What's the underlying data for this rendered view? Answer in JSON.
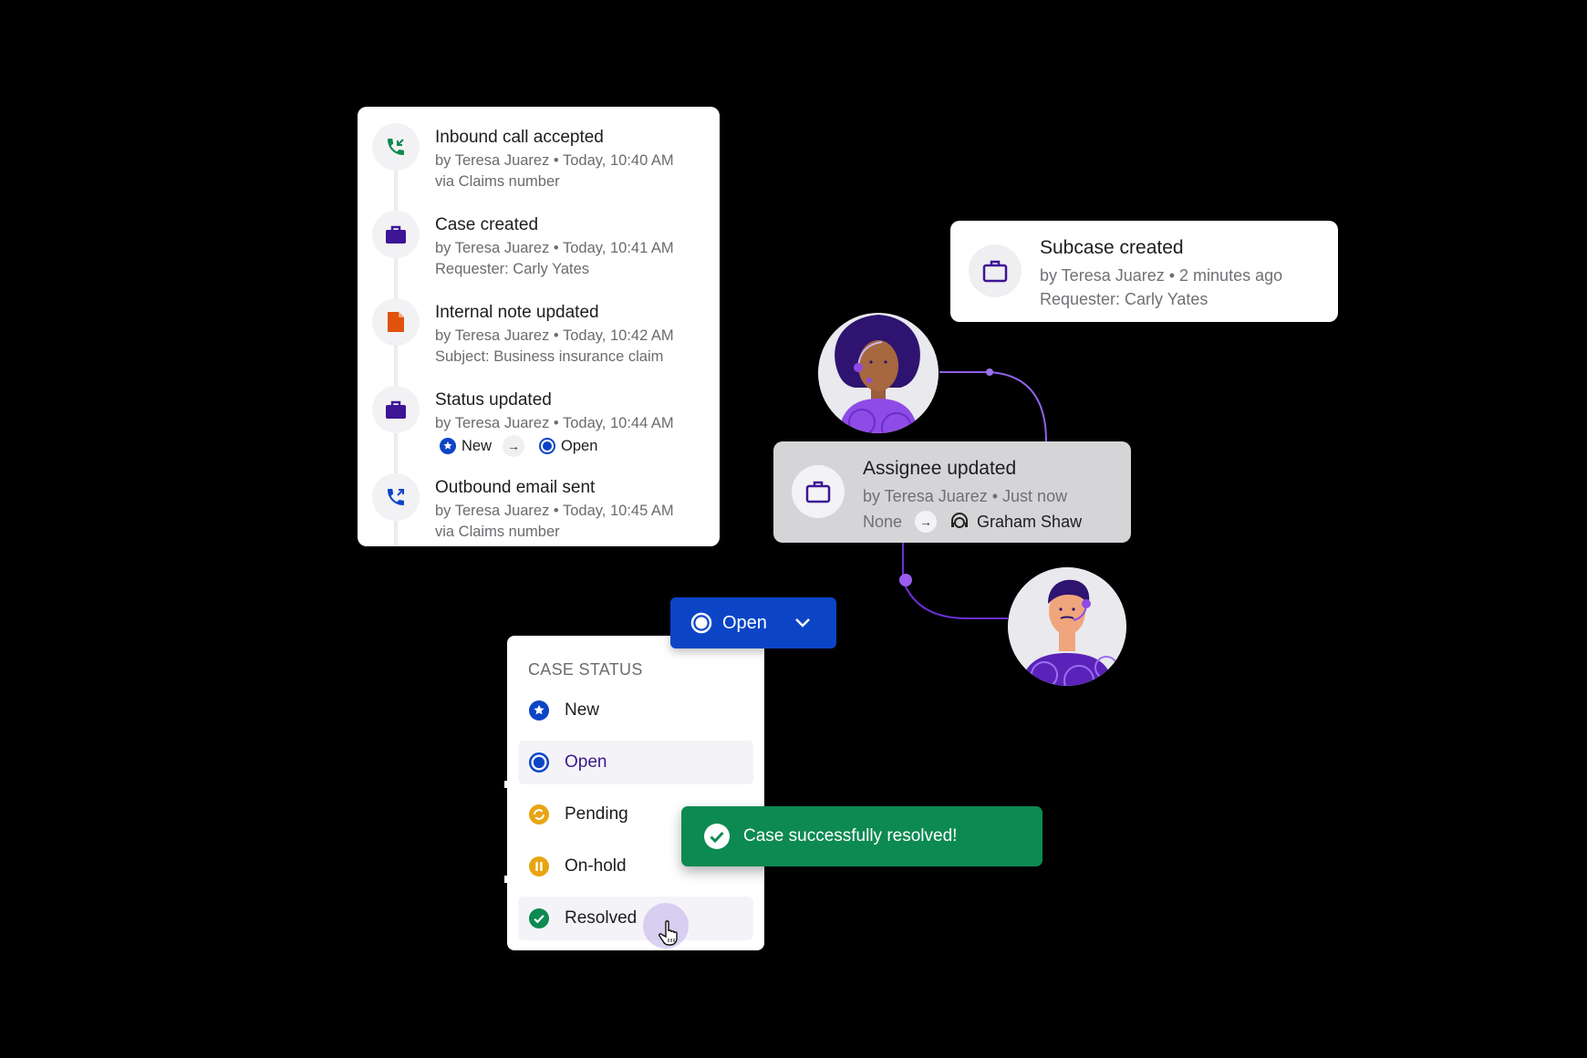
{
  "timeline": {
    "items": [
      {
        "icon": "inbound-call-icon",
        "title": "Inbound call accepted",
        "meta": "by Teresa Juarez • Today, 10:40 AM",
        "detail": "via Claims number"
      },
      {
        "icon": "briefcase-icon",
        "title": "Case created",
        "meta": "by Teresa Juarez • Today, 10:41 AM",
        "detail": "Requester: Carly Yates"
      },
      {
        "icon": "note-icon",
        "title": "Internal note updated",
        "meta": "by Teresa Juarez • Today, 10:42 AM",
        "detail": "Subject: Business insurance claim"
      },
      {
        "icon": "briefcase-icon",
        "title": "Status updated",
        "meta": "by Teresa Juarez • Today, 10:44 AM",
        "from_status": "New",
        "to_status": "Open"
      },
      {
        "icon": "outbound-call-icon",
        "title": "Outbound email sent",
        "meta": "by Teresa Juarez • Today, 10:45 AM",
        "detail": "via Claims number"
      }
    ]
  },
  "subcase_card": {
    "title": "Subcase created",
    "meta": "by Teresa Juarez • 2 minutes ago",
    "detail": "Requester: Carly Yates"
  },
  "assignee_card": {
    "title": "Assignee updated",
    "meta": "by Teresa Juarez • Just now",
    "from": "None",
    "to": "Graham Shaw"
  },
  "status_button": {
    "label": "Open"
  },
  "case_status_menu": {
    "title": "CASE STATUS",
    "options": [
      {
        "label": "New",
        "icon": "star-icon"
      },
      {
        "label": "Open",
        "icon": "open-circle-icon",
        "selected": true
      },
      {
        "label": "Pending",
        "icon": "pending-icon"
      },
      {
        "label": "On-hold",
        "icon": "pause-icon"
      },
      {
        "label": "Resolved",
        "icon": "check-icon",
        "hovered": true
      }
    ]
  },
  "toast": {
    "message": "Case successfully resolved!"
  },
  "colors": {
    "brand_blue": "#0b45c6",
    "success_green": "#0d8a52",
    "purple": "#3d1596",
    "orange": "#e0520e",
    "amber": "#e8a512",
    "accent_violet": "#9a5cf0"
  }
}
